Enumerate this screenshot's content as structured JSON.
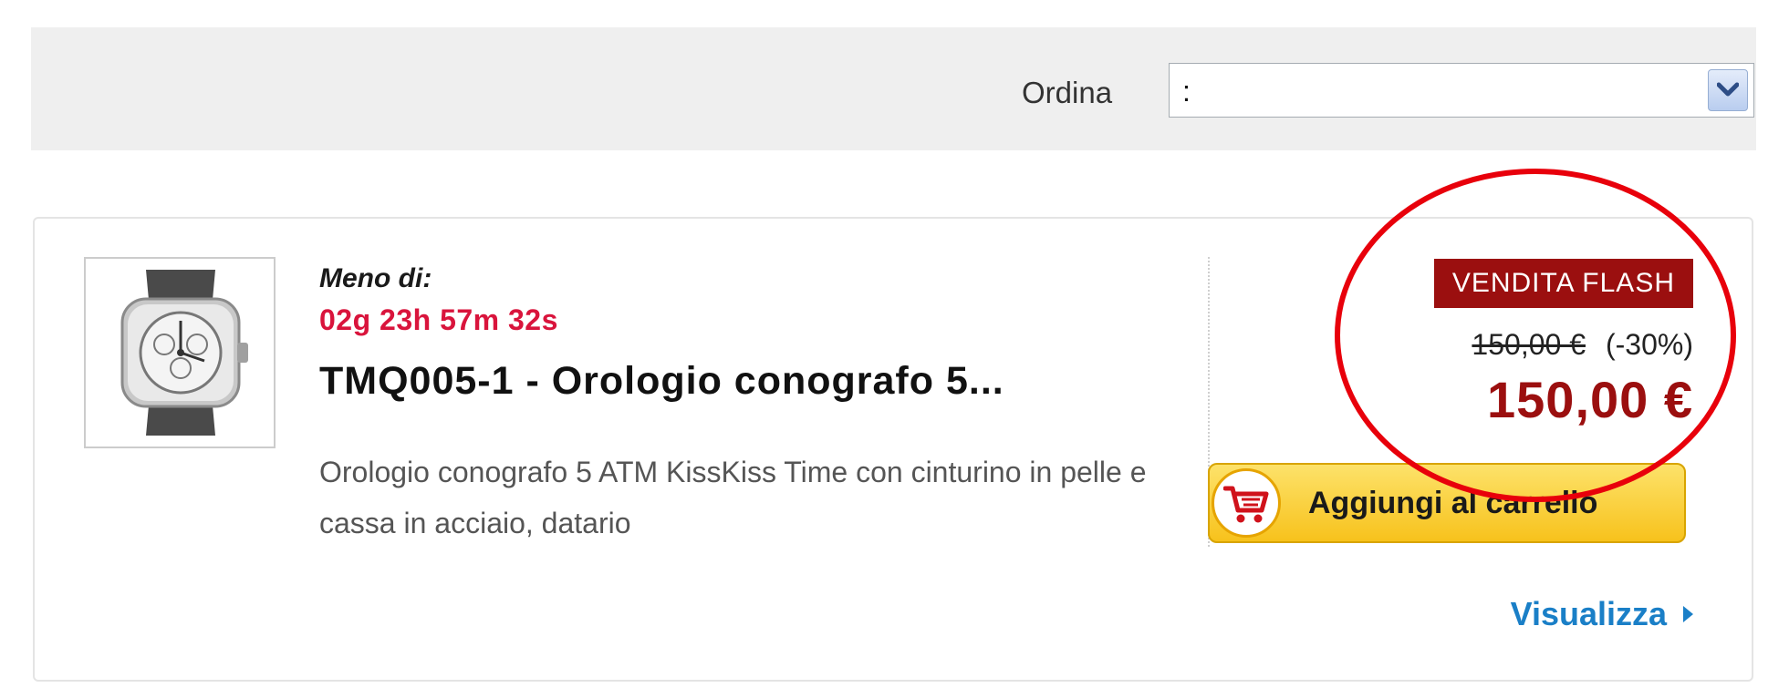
{
  "sort": {
    "label": "Ordina",
    "selected_value": ":"
  },
  "product": {
    "countdown_label": "Meno di:",
    "countdown": "02g 23h 57m 32s",
    "title": "TMQ005-1 - Orologio conografo 5...",
    "description": "Orologio conografo 5 ATM KissKiss Time con cinturino in pelle e cassa in acciaio, datario",
    "badge": "VENDITA FLASH",
    "old_price": "150,00 €",
    "discount": "(-30%)",
    "final_price": "150,00 €",
    "cart_button_label": "Aggiungi al carrello",
    "view_link_label": "Visualizza"
  },
  "colors": {
    "accent_red": "#9b0f0f",
    "countdown_red": "#d9143c",
    "link_blue": "#1a7fc7",
    "button_yellow": "#f7c21c",
    "annotation_red": "#e8000b"
  },
  "icons": {
    "select_arrow": "chevron-down-icon",
    "cart": "shopping-cart-icon",
    "view_link": "chevron-right-icon"
  }
}
